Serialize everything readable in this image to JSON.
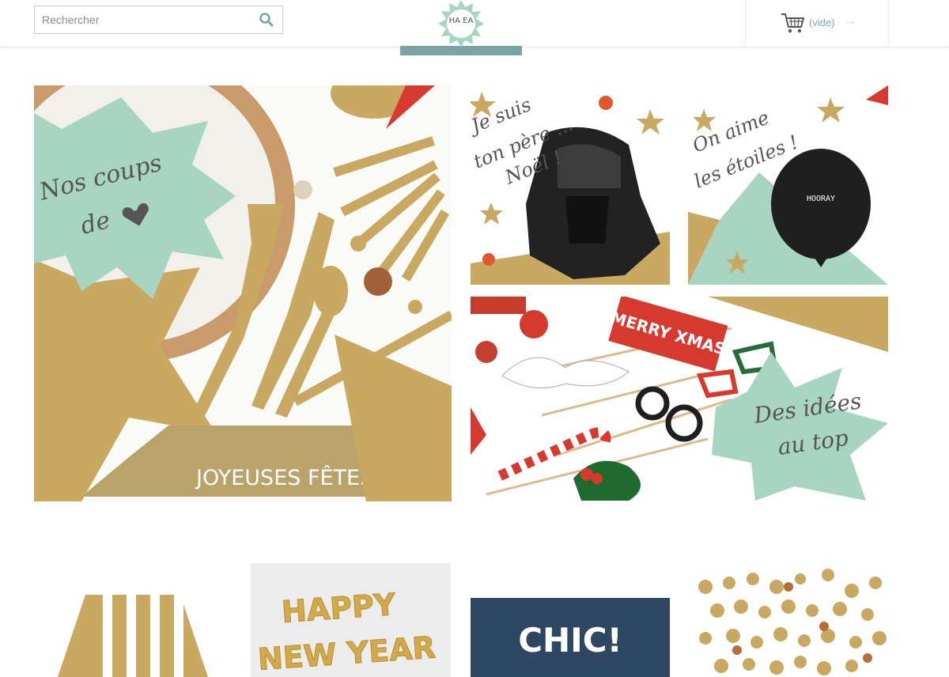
{
  "header": {
    "search": {
      "placeholder": "Rechercher",
      "value": ""
    },
    "logo_text": "HA EA",
    "cart": {
      "label": "(vide)"
    }
  },
  "featured": {
    "main": {
      "text_line1": "Nos coups",
      "text_line2": "de"
    },
    "pere_noel": {
      "text_line1": "Je suis",
      "text_line2": "ton père ...",
      "text_line3": "Noël !"
    },
    "etoiles": {
      "text_line1": "On aime",
      "text_line2": "les étoiles !",
      "balloon_text": "HOORAY"
    },
    "idees": {
      "text_line1": "Des idées",
      "text_line2": "au top",
      "props_text": "MERRY XMAS"
    },
    "napkins_text": "JOYEUSES FÊTES"
  },
  "products": [
    {
      "name": "gold-striped-plate"
    },
    {
      "name": "happy-new-year-balloons",
      "text_line1": "HAPPY",
      "text_line2": "NEW YEAR"
    },
    {
      "name": "chic-card",
      "text": "CHIC!"
    },
    {
      "name": "gold-confetti"
    }
  ],
  "colors": {
    "mint": "#a8d5c2",
    "gold": "#c9a961",
    "accent_blue": "#7fa6c2",
    "band": "#7aa3a7",
    "navy": "#2e4763",
    "red": "#d63a2f"
  }
}
